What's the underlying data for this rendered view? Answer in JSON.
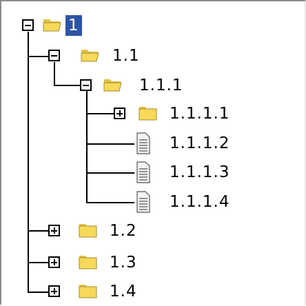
{
  "tree": {
    "nodes": [
      {
        "id": "n1",
        "label": "1",
        "type": "folder-open",
        "toggle": "minus",
        "selected": true
      },
      {
        "id": "n1-1",
        "label": "1.1",
        "type": "folder-open",
        "toggle": "minus"
      },
      {
        "id": "n1-1-1",
        "label": "1.1.1",
        "type": "folder-open",
        "toggle": "minus"
      },
      {
        "id": "n1-1-1-1",
        "label": "1.1.1.1",
        "type": "folder",
        "toggle": "plus"
      },
      {
        "id": "n1-1-1-2",
        "label": "1.1.1.2",
        "type": "document"
      },
      {
        "id": "n1-1-1-3",
        "label": "1.1.1.3",
        "type": "document"
      },
      {
        "id": "n1-1-1-4",
        "label": "1.1.1.4",
        "type": "document"
      },
      {
        "id": "n1-2",
        "label": "1.2",
        "type": "folder",
        "toggle": "plus"
      },
      {
        "id": "n1-3",
        "label": "1.3",
        "type": "folder",
        "toggle": "plus"
      },
      {
        "id": "n1-4",
        "label": "1.4",
        "type": "folder",
        "toggle": "plus"
      }
    ]
  },
  "colors": {
    "selection": "#2d55a6",
    "folder": "#f7d95a",
    "tree_lines": "#000000"
  },
  "icons": {
    "folder_open": "folder-open-icon",
    "folder_closed": "folder-icon",
    "document": "document-icon",
    "expand": "plus-box-icon",
    "collapse": "minus-box-icon"
  }
}
